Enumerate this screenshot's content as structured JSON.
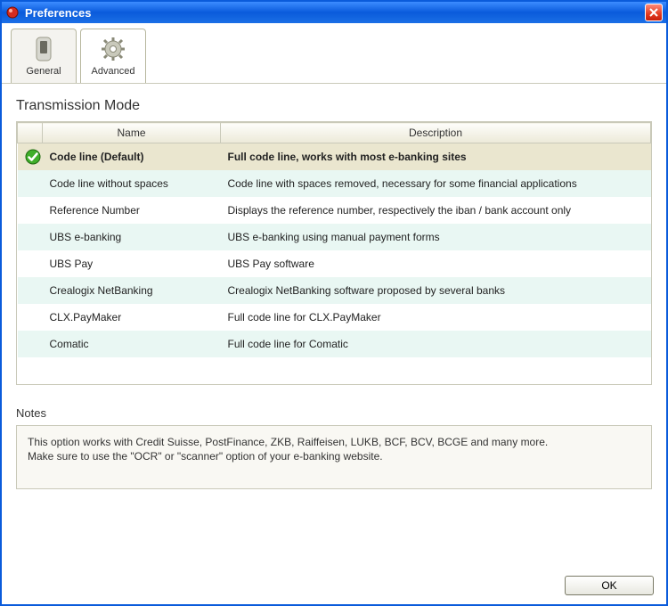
{
  "window": {
    "title": "Preferences"
  },
  "tabs": [
    {
      "label": "General",
      "selected": false
    },
    {
      "label": "Advanced",
      "selected": true
    }
  ],
  "transmission": {
    "heading": "Transmission Mode",
    "columns": {
      "name": "Name",
      "description": "Description"
    },
    "selected_index": 0,
    "modes": [
      {
        "name": "Code line (Default)",
        "description": "Full code line, works with most e-banking sites"
      },
      {
        "name": "Code line without spaces",
        "description": "Code line with spaces removed, necessary for some financial applications"
      },
      {
        "name": "Reference Number",
        "description": "Displays the reference number, respectively the iban / bank account only"
      },
      {
        "name": "UBS e-banking",
        "description": "UBS e-banking using manual payment forms"
      },
      {
        "name": "UBS Pay",
        "description": "UBS Pay software"
      },
      {
        "name": "Crealogix NetBanking",
        "description": "Crealogix NetBanking software proposed by several banks"
      },
      {
        "name": "CLX.PayMaker",
        "description": "Full code line for CLX.PayMaker"
      },
      {
        "name": "Comatic",
        "description": "Full code line for Comatic"
      }
    ]
  },
  "notes": {
    "heading": "Notes",
    "line1": "This option works with Credit Suisse, PostFinance, ZKB, Raiffeisen, LUKB, BCF, BCV, BCGE and many more.",
    "line2": "Make sure to use the \"OCR\" or \"scanner\" option of your e-banking website."
  },
  "buttons": {
    "ok": "OK"
  }
}
